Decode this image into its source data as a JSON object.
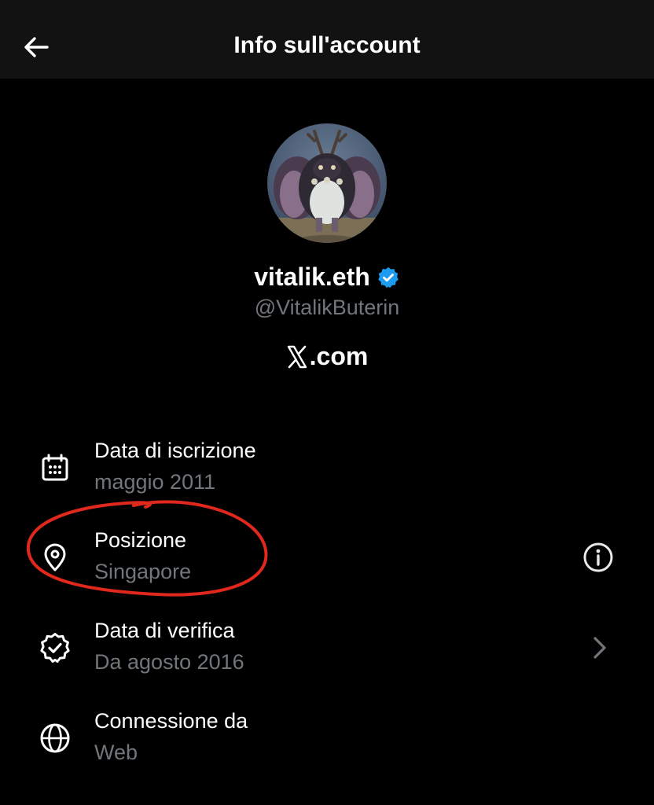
{
  "header": {
    "title": "Info sull'account",
    "back_icon": "arrow-left-icon"
  },
  "profile": {
    "display_name": "vitalik.eth",
    "handle": "@VitalikButerin",
    "verified_icon": "verified-badge-icon",
    "source_text": ".com",
    "source_logo": "X"
  },
  "rows": [
    {
      "label": "Data di iscrizione",
      "value": "maggio 2011",
      "icon": "calendar-icon"
    },
    {
      "label": "Posizione",
      "value": "Singapore",
      "icon": "location-pin-icon",
      "action_icon": "info-icon"
    },
    {
      "label": "Data di verifica",
      "value": "Da agosto 2016",
      "icon": "verified-check-icon",
      "action_icon": "chevron-right-icon"
    },
    {
      "label": "Connessione da",
      "value": "Web",
      "icon": "globe-icon"
    }
  ],
  "colors": {
    "background": "#000000",
    "header_bg": "#121212",
    "primary_text": "#ffffff",
    "secondary_text": "#71767b",
    "verified_blue": "#1d9bf0",
    "annotation_red": "#e0281c"
  }
}
